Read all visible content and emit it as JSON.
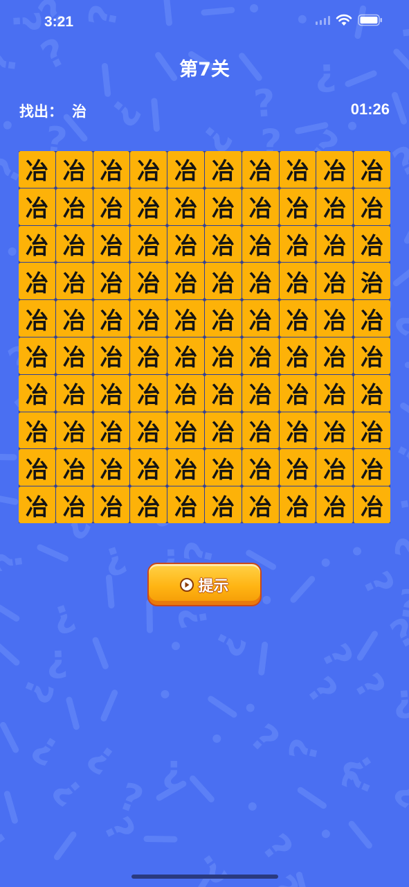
{
  "status_bar": {
    "time": "3:21"
  },
  "level": {
    "title": "第7关"
  },
  "target": {
    "label": "找出：",
    "char": "治",
    "timer": "01:26"
  },
  "grid": {
    "rows": 10,
    "cols": 10,
    "cells": [
      [
        "冶",
        "冶",
        "冶",
        "冶",
        "冶",
        "冶",
        "冶",
        "冶",
        "冶",
        "冶"
      ],
      [
        "冶",
        "冶",
        "冶",
        "冶",
        "冶",
        "冶",
        "冶",
        "冶",
        "冶",
        "冶"
      ],
      [
        "冶",
        "冶",
        "冶",
        "冶",
        "冶",
        "冶",
        "冶",
        "冶",
        "冶",
        "冶"
      ],
      [
        "冶",
        "冶",
        "冶",
        "冶",
        "冶",
        "冶",
        "冶",
        "冶",
        "冶",
        "治"
      ],
      [
        "冶",
        "冶",
        "冶",
        "冶",
        "冶",
        "冶",
        "冶",
        "冶",
        "冶",
        "冶"
      ],
      [
        "冶",
        "冶",
        "冶",
        "冶",
        "冶",
        "冶",
        "冶",
        "冶",
        "冶",
        "冶"
      ],
      [
        "冶",
        "冶",
        "冶",
        "冶",
        "冶",
        "冶",
        "冶",
        "冶",
        "冶",
        "冶"
      ],
      [
        "冶",
        "冶",
        "冶",
        "冶",
        "冶",
        "冶",
        "冶",
        "冶",
        "冶",
        "冶"
      ],
      [
        "冶",
        "冶",
        "冶",
        "冶",
        "冶",
        "冶",
        "冶",
        "冶",
        "冶",
        "冶"
      ],
      [
        "冶",
        "冶",
        "冶",
        "冶",
        "冶",
        "冶",
        "冶",
        "冶",
        "冶",
        "冶"
      ]
    ]
  },
  "hint_button": {
    "label": "提示",
    "icon": "play-icon"
  },
  "colors": {
    "background": "#4a6ff2",
    "pattern": "#5c80f6",
    "tile": "#fdb208",
    "button": "#ffb413"
  }
}
